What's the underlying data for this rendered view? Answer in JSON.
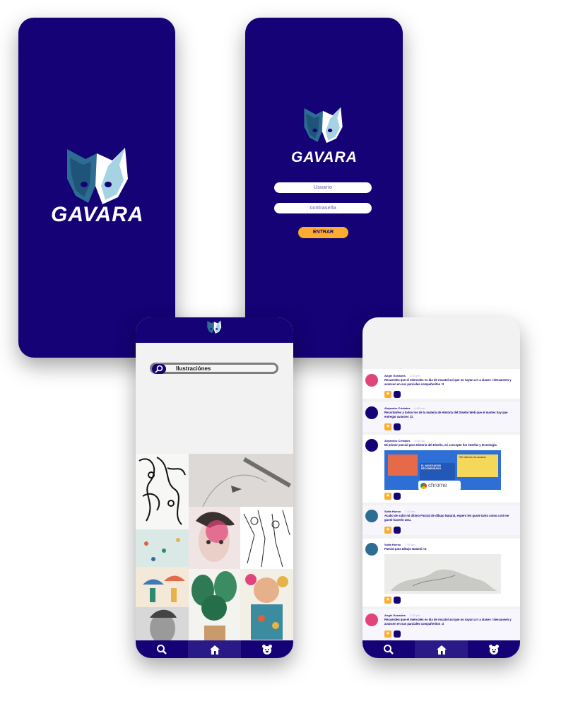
{
  "brand": {
    "name": "GAVARA",
    "navy": "#140276",
    "accent": "#fcad2f",
    "teal": "#2e6d93",
    "light_teal": "#a5d3e3"
  },
  "login": {
    "username_placeholder": "Usuario",
    "password_placeholder": "contraseña",
    "enter_label": "ENTRAR"
  },
  "gallery": {
    "search_value": "Ilustraciónes",
    "icons": [
      "search-icon",
      "home-icon",
      "profile-bear-icon"
    ]
  },
  "feed": {
    "posts": [
      {
        "author": "Angie Gonzales",
        "time": "3:30 pm",
        "text": "Recuerden que el miercoles es dia de Ascatol asi que no vayan a ir a clases ! descansen y avancen en sus parciales compañeritos :3",
        "avatar": "pink"
      },
      {
        "author": "Alejandro Cristales",
        "time": "4:00 pm",
        "text": "Recordarles a todos los de la materia de Historia del Diseño Web que el martes hay que entregar avances :D.",
        "avatar": "navy"
      },
      {
        "author": "Alejandro Cristales",
        "time": "5:00 pm",
        "text": "Mi primer parcial para Historia del Diseño, mi concepto fue interfaz y tecnologia",
        "avatar": "navy",
        "image_texts": [
          "EL NAVEGADOR RECOMENDADO",
          "chrome",
          "750 millones de usuarios"
        ]
      },
      {
        "author": "Sofia Hueso",
        "time": "7:42 am",
        "text": "Acabo de subir mi último Parcial de dibujo Natural, espero les guste tanto como a mi me gustó hacerlo uwu.",
        "avatar": "teal"
      },
      {
        "author": "Sofia Hueso",
        "time": "7:55 am",
        "text": "Parcial para Dibujo Natural <3",
        "avatar": "teal"
      },
      {
        "author": "Angie Gonzales",
        "time": "3:30 pm",
        "text": "Recuerden que el miercoles es dia de Ascatol asi que no vayan a ir a clases ! descansen y avancen en sus parciales compañeritos :3",
        "avatar": "pink"
      }
    ]
  }
}
